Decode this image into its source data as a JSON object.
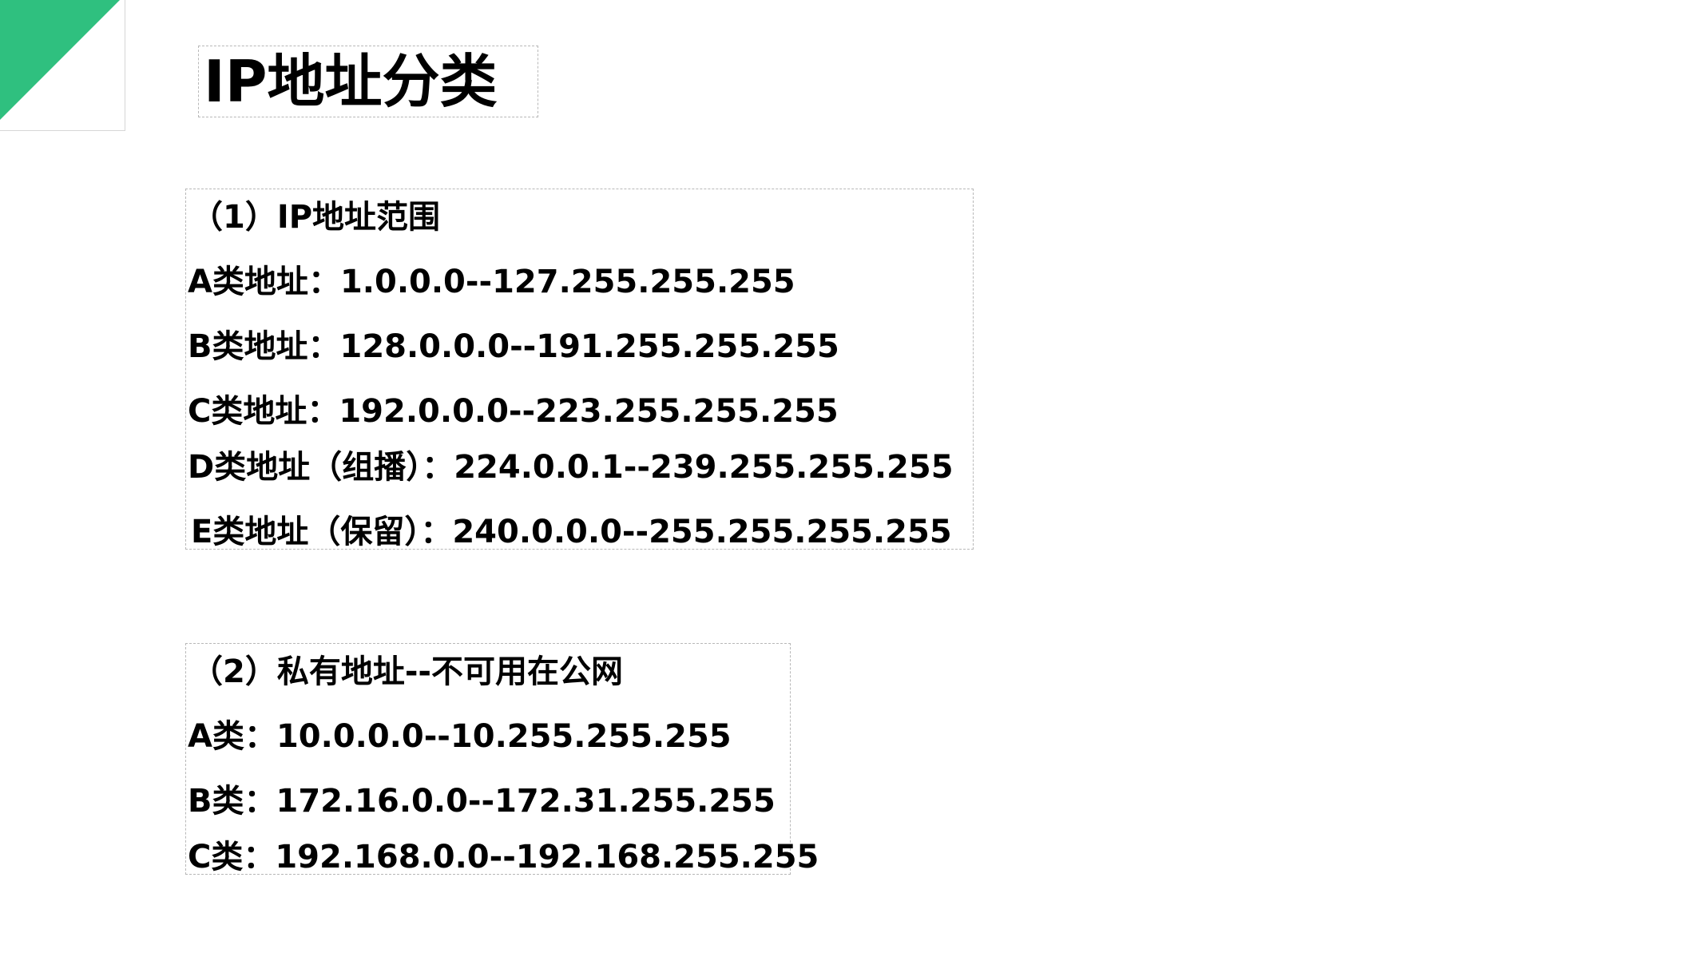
{
  "slide": {
    "accent_color": "#2fc07f",
    "title": "IP地址分类"
  },
  "section1": {
    "heading": "（1）IP地址范围",
    "lines": [
      "A类地址：1.0.0.0--127.255.255.255",
      "B类地址：128.0.0.0--191.255.255.255",
      "C类地址：192.0.0.0--223.255.255.255",
      "D类地址（组播）：224.0.0.1--239.255.255.255",
      "E类地址（保留）：240.0.0.0--255.255.255.255"
    ]
  },
  "section2": {
    "heading": "（2）私有地址--不可用在公网",
    "lines": [
      "A类：10.0.0.0--10.255.255.255",
      "B类：172.16.0.0--172.31.255.255",
      "C类：192.168.0.0--192.168.255.255"
    ]
  }
}
